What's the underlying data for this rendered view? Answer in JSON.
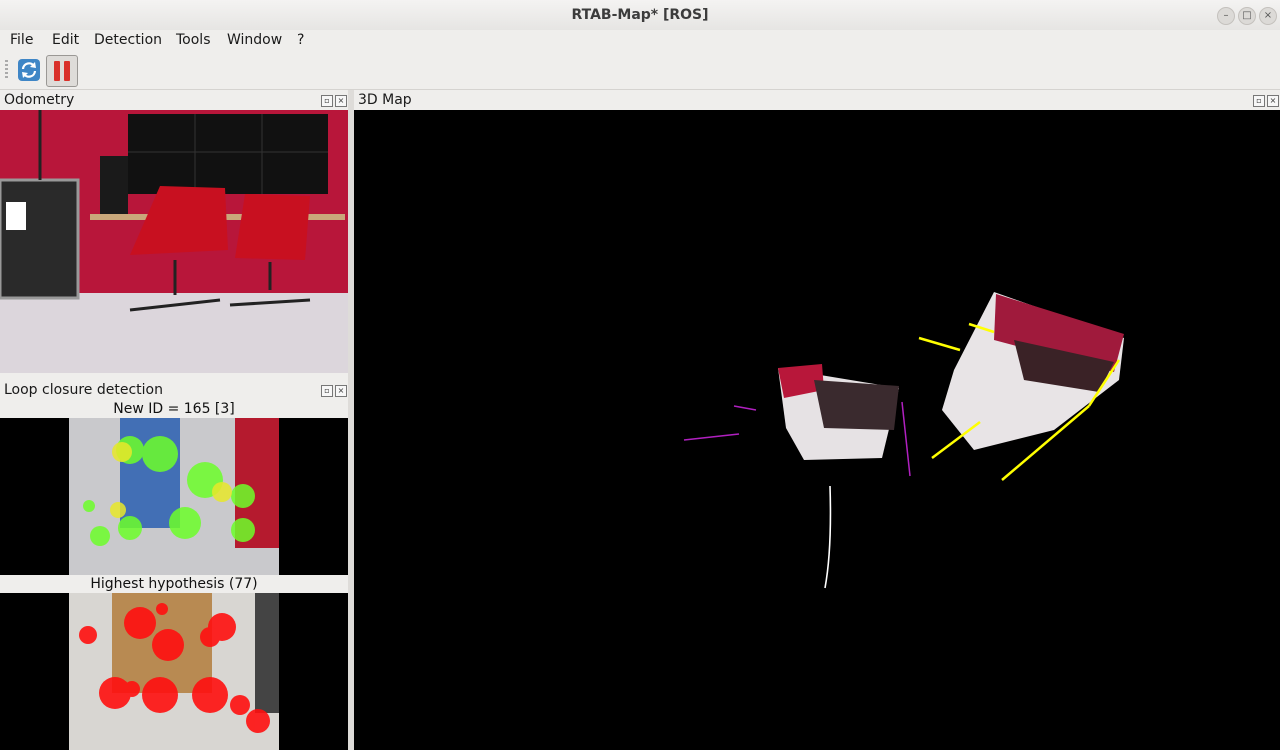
{
  "window": {
    "title": "RTAB-Map* [ROS]",
    "minimize": "–",
    "maximize": "□",
    "close": "×"
  },
  "menu": {
    "file": "File",
    "edit": "Edit",
    "detection": "Detection",
    "tools": "Tools",
    "window": "Window",
    "help": "?"
  },
  "docks": {
    "odometry": {
      "title": "Odometry"
    },
    "loop_closure": {
      "title": "Loop closure detection",
      "new_id_caption": "New ID = 165 [3]",
      "hypothesis_caption": "Highest hypothesis (77)"
    },
    "map3d": {
      "title": "3D Map"
    }
  },
  "dock_controls": {
    "float": "▫",
    "close": "×"
  },
  "colors": {
    "background": "#000000",
    "accent_red": "#c8102e",
    "pause_button": "#d9302a",
    "trajectory": "#ffff00"
  }
}
